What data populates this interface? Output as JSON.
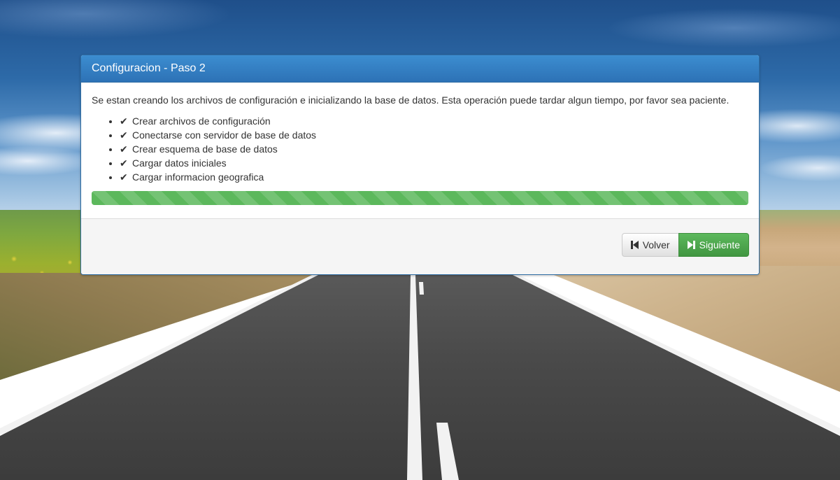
{
  "panel": {
    "title": "Configuracion - Paso 2",
    "intro": "Se estan creando los archivos de configuración e inicializando la base de datos. Esta operación puede tardar algun tiempo, por favor sea paciente.",
    "steps": [
      {
        "label": "Crear archivos de configuración",
        "icon": "check-icon"
      },
      {
        "label": "Conectarse con servidor de base de datos",
        "icon": "check-icon"
      },
      {
        "label": "Crear esquema de base de datos",
        "icon": "check-icon"
      },
      {
        "label": "Cargar datos iniciales",
        "icon": "check-icon"
      },
      {
        "label": "Cargar informacion geografica",
        "icon": "check-icon"
      }
    ],
    "progress_percent": 100,
    "progress_color": "#5cb85c"
  },
  "footer": {
    "back_label": "Volver",
    "back_icon": "step-backward-icon",
    "next_label": "Siguiente",
    "next_icon": "step-forward-icon"
  }
}
